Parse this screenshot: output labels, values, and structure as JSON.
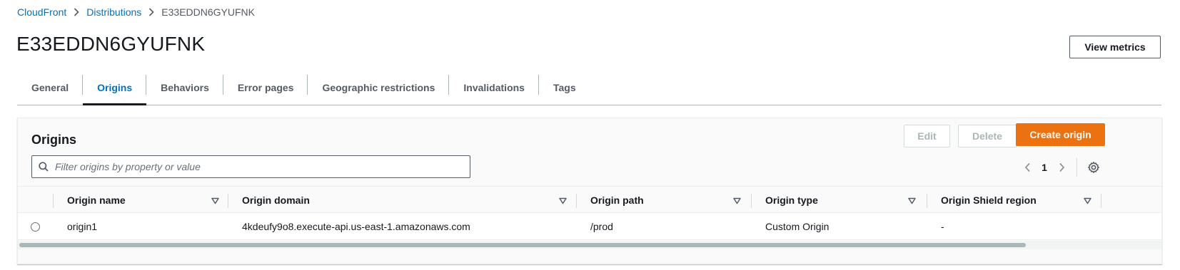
{
  "breadcrumb": {
    "items": [
      {
        "label": "CloudFront"
      },
      {
        "label": "Distributions"
      }
    ],
    "current": "E33EDDN6GYUFNK"
  },
  "page": {
    "title": "E33EDDN6GYUFNK",
    "view_metrics_label": "View metrics"
  },
  "tabs": [
    {
      "label": "General"
    },
    {
      "label": "Origins",
      "active": true
    },
    {
      "label": "Behaviors"
    },
    {
      "label": "Error pages"
    },
    {
      "label": "Geographic restrictions"
    },
    {
      "label": "Invalidations"
    },
    {
      "label": "Tags"
    }
  ],
  "panel": {
    "title": "Origins",
    "edit_label": "Edit",
    "delete_label": "Delete",
    "create_label": "Create origin",
    "filter_placeholder": "Filter origins by property or value",
    "page_number": "1"
  },
  "table": {
    "columns": [
      "Origin name",
      "Origin domain",
      "Origin path",
      "Origin type",
      "Origin Shield region"
    ],
    "rows": [
      {
        "name": "origin1",
        "domain": "4kdeufy9o8.execute-api.us-east-1.amazonaws.com",
        "path": "/prod",
        "type": "Custom Origin",
        "shield_region": "-"
      }
    ]
  },
  "colors": {
    "link": "#0073bb",
    "primary_button": "#ec7211",
    "text": "#16191f"
  },
  "icons": {
    "breadcrumb_separator": "chevron-right-icon",
    "search": "search-icon",
    "sort": "sort-down-icon",
    "prev": "chevron-left-icon",
    "next": "chevron-right-icon",
    "settings": "gear-icon"
  }
}
